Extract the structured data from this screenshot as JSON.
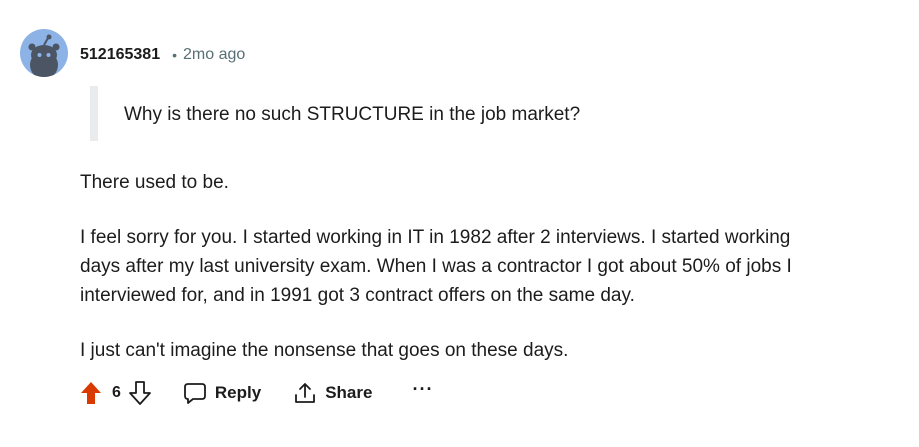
{
  "comment": {
    "author": "512165381",
    "separator": "•",
    "time": "2mo ago",
    "quote": "Why is there no such STRUCTURE in the job market?",
    "paragraphs": [
      [
        "There used to be."
      ],
      [
        "I feel sorry for you. I started working in IT in 1982 after 2 interviews. I started working",
        "days after my last university exam. When I was a contractor I got about 50% of jobs I",
        "interviewed for, and in 1991 got 3 contract offers on the same day."
      ],
      [
        "I just can't imagine the nonsense that goes on these days."
      ]
    ]
  },
  "actions": {
    "score": "6",
    "reply_label": "Reply",
    "share_label": "Share",
    "more_label": "···",
    "upvote_color": "#d93a00"
  },
  "icons": [
    "avatar-snoo",
    "upvote-arrow",
    "downvote-arrow",
    "reply-bubble",
    "share-arrow",
    "more-dots"
  ]
}
